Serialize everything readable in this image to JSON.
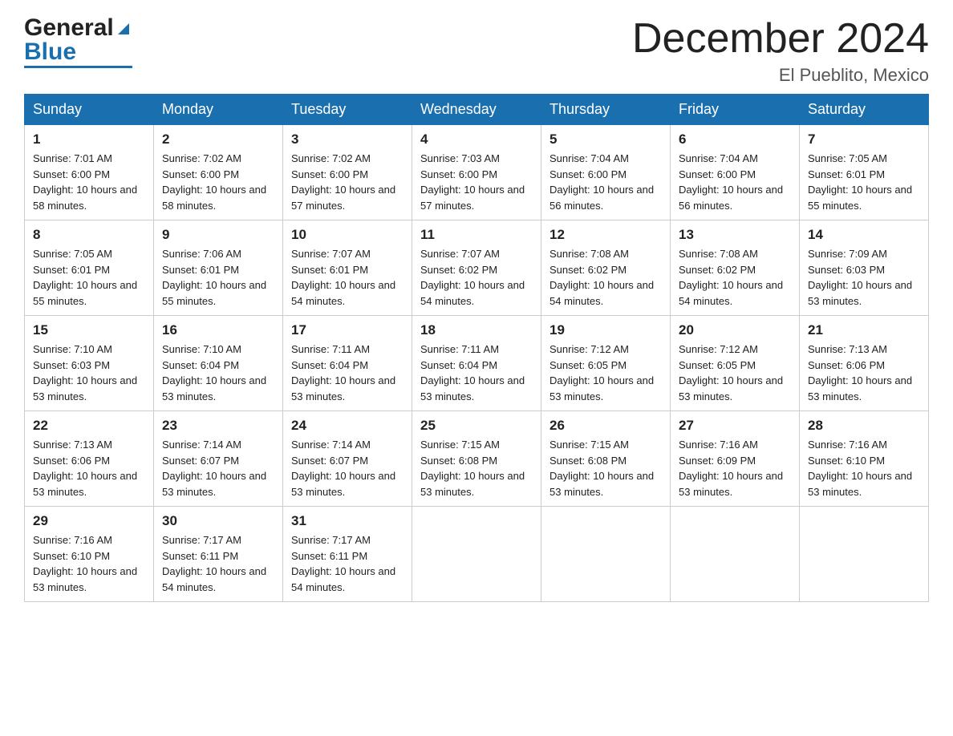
{
  "header": {
    "logo_general": "General",
    "logo_blue": "Blue",
    "month_title": "December 2024",
    "location": "El Pueblito, Mexico"
  },
  "days_of_week": [
    "Sunday",
    "Monday",
    "Tuesday",
    "Wednesday",
    "Thursday",
    "Friday",
    "Saturday"
  ],
  "weeks": [
    [
      {
        "day": "1",
        "sunrise": "7:01 AM",
        "sunset": "6:00 PM",
        "daylight": "10 hours and 58 minutes."
      },
      {
        "day": "2",
        "sunrise": "7:02 AM",
        "sunset": "6:00 PM",
        "daylight": "10 hours and 58 minutes."
      },
      {
        "day": "3",
        "sunrise": "7:02 AM",
        "sunset": "6:00 PM",
        "daylight": "10 hours and 57 minutes."
      },
      {
        "day": "4",
        "sunrise": "7:03 AM",
        "sunset": "6:00 PM",
        "daylight": "10 hours and 57 minutes."
      },
      {
        "day": "5",
        "sunrise": "7:04 AM",
        "sunset": "6:00 PM",
        "daylight": "10 hours and 56 minutes."
      },
      {
        "day": "6",
        "sunrise": "7:04 AM",
        "sunset": "6:00 PM",
        "daylight": "10 hours and 56 minutes."
      },
      {
        "day": "7",
        "sunrise": "7:05 AM",
        "sunset": "6:01 PM",
        "daylight": "10 hours and 55 minutes."
      }
    ],
    [
      {
        "day": "8",
        "sunrise": "7:05 AM",
        "sunset": "6:01 PM",
        "daylight": "10 hours and 55 minutes."
      },
      {
        "day": "9",
        "sunrise": "7:06 AM",
        "sunset": "6:01 PM",
        "daylight": "10 hours and 55 minutes."
      },
      {
        "day": "10",
        "sunrise": "7:07 AM",
        "sunset": "6:01 PM",
        "daylight": "10 hours and 54 minutes."
      },
      {
        "day": "11",
        "sunrise": "7:07 AM",
        "sunset": "6:02 PM",
        "daylight": "10 hours and 54 minutes."
      },
      {
        "day": "12",
        "sunrise": "7:08 AM",
        "sunset": "6:02 PM",
        "daylight": "10 hours and 54 minutes."
      },
      {
        "day": "13",
        "sunrise": "7:08 AM",
        "sunset": "6:02 PM",
        "daylight": "10 hours and 54 minutes."
      },
      {
        "day": "14",
        "sunrise": "7:09 AM",
        "sunset": "6:03 PM",
        "daylight": "10 hours and 53 minutes."
      }
    ],
    [
      {
        "day": "15",
        "sunrise": "7:10 AM",
        "sunset": "6:03 PM",
        "daylight": "10 hours and 53 minutes."
      },
      {
        "day": "16",
        "sunrise": "7:10 AM",
        "sunset": "6:04 PM",
        "daylight": "10 hours and 53 minutes."
      },
      {
        "day": "17",
        "sunrise": "7:11 AM",
        "sunset": "6:04 PM",
        "daylight": "10 hours and 53 minutes."
      },
      {
        "day": "18",
        "sunrise": "7:11 AM",
        "sunset": "6:04 PM",
        "daylight": "10 hours and 53 minutes."
      },
      {
        "day": "19",
        "sunrise": "7:12 AM",
        "sunset": "6:05 PM",
        "daylight": "10 hours and 53 minutes."
      },
      {
        "day": "20",
        "sunrise": "7:12 AM",
        "sunset": "6:05 PM",
        "daylight": "10 hours and 53 minutes."
      },
      {
        "day": "21",
        "sunrise": "7:13 AM",
        "sunset": "6:06 PM",
        "daylight": "10 hours and 53 minutes."
      }
    ],
    [
      {
        "day": "22",
        "sunrise": "7:13 AM",
        "sunset": "6:06 PM",
        "daylight": "10 hours and 53 minutes."
      },
      {
        "day": "23",
        "sunrise": "7:14 AM",
        "sunset": "6:07 PM",
        "daylight": "10 hours and 53 minutes."
      },
      {
        "day": "24",
        "sunrise": "7:14 AM",
        "sunset": "6:07 PM",
        "daylight": "10 hours and 53 minutes."
      },
      {
        "day": "25",
        "sunrise": "7:15 AM",
        "sunset": "6:08 PM",
        "daylight": "10 hours and 53 minutes."
      },
      {
        "day": "26",
        "sunrise": "7:15 AM",
        "sunset": "6:08 PM",
        "daylight": "10 hours and 53 minutes."
      },
      {
        "day": "27",
        "sunrise": "7:16 AM",
        "sunset": "6:09 PM",
        "daylight": "10 hours and 53 minutes."
      },
      {
        "day": "28",
        "sunrise": "7:16 AM",
        "sunset": "6:10 PM",
        "daylight": "10 hours and 53 minutes."
      }
    ],
    [
      {
        "day": "29",
        "sunrise": "7:16 AM",
        "sunset": "6:10 PM",
        "daylight": "10 hours and 53 minutes."
      },
      {
        "day": "30",
        "sunrise": "7:17 AM",
        "sunset": "6:11 PM",
        "daylight": "10 hours and 54 minutes."
      },
      {
        "day": "31",
        "sunrise": "7:17 AM",
        "sunset": "6:11 PM",
        "daylight": "10 hours and 54 minutes."
      },
      null,
      null,
      null,
      null
    ]
  ],
  "labels": {
    "sunrise": "Sunrise:",
    "sunset": "Sunset:",
    "daylight": "Daylight:"
  }
}
